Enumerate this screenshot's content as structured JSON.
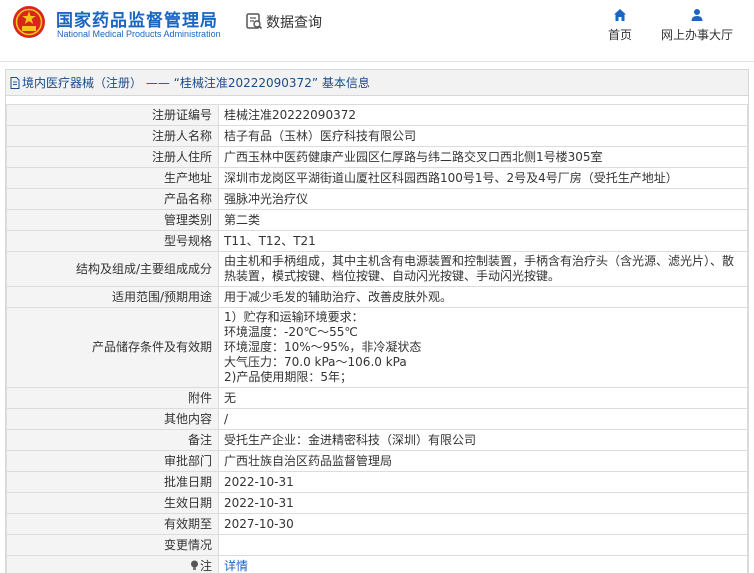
{
  "header": {
    "org_name_cn": "国家药品监督管理局",
    "org_name_en": "National Medical Products Administration",
    "page_title": "数据查询",
    "nav": [
      {
        "label": "首页",
        "icon": "home-icon"
      },
      {
        "label": "网上办事大厅",
        "icon": "user-icon"
      }
    ]
  },
  "panel": {
    "title": "境内医疗器械（注册） —— “桂械注准20222090372” 基本信息"
  },
  "records": [
    {
      "label": "注册证编号",
      "value": "桂械注准20222090372"
    },
    {
      "label": "注册人名称",
      "value": "桔子有品（玉林）医疗科技有限公司"
    },
    {
      "label": "注册人住所",
      "value": "广西玉林中医药健康产业园区仁厚路与纬二路交叉口西北侧1号楼305室"
    },
    {
      "label": "生产地址",
      "value": "深圳市龙岗区平湖街道山厦社区科园西路100号1号、2号及4号厂房（受托生产地址）"
    },
    {
      "label": "产品名称",
      "value": "强脉冲光治疗仪"
    },
    {
      "label": "管理类别",
      "value": "第二类"
    },
    {
      "label": "型号规格",
      "value": "T11、T12、T21"
    },
    {
      "label": "结构及组成/主要组成成分",
      "value": "由主机和手柄组成，其中主机含有电源装置和控制装置，手柄含有治疗头（含光源、滤光片）、散热装置，模式按键、档位按键、自动闪光按键、手动闪光按键。"
    },
    {
      "label": "适用范围/预期用途",
      "value": "用于减少毛发的辅助治疗、改善皮肤外观。"
    },
    {
      "label": "产品储存条件及有效期",
      "value": "1）贮存和运输环境要求：\n环境温度：-20℃～55℃\n环境湿度：10%～95%，非冷凝状态\n大气压力：70.0 kPa～106.0 kPa\n2)产品使用期限：5年；"
    },
    {
      "label": "附件",
      "value": "无"
    },
    {
      "label": "其他内容",
      "value": "/"
    },
    {
      "label": "备注",
      "value": "受托生产企业：金进精密科技（深圳）有限公司"
    },
    {
      "label": "审批部门",
      "value": "广西壮族自治区药品监督管理局"
    },
    {
      "label": "批准日期",
      "value": "2022-10-31"
    },
    {
      "label": "生效日期",
      "value": "2022-10-31"
    },
    {
      "label": "有效期至",
      "value": "2027-10-30"
    },
    {
      "label": "变更情况",
      "value": ""
    },
    {
      "label": "注",
      "value": "详情"
    }
  ]
}
